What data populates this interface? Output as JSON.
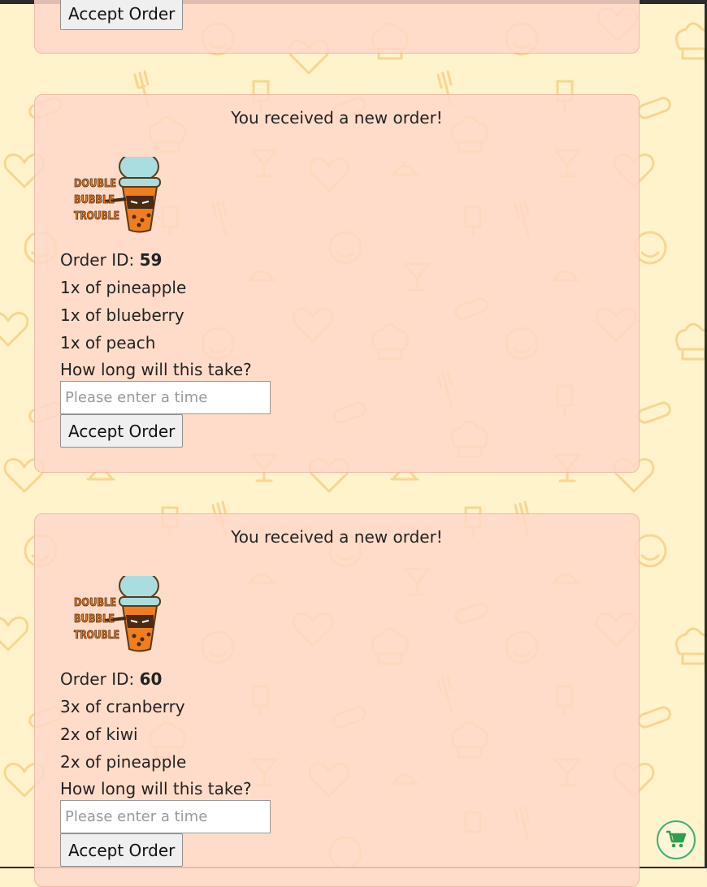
{
  "orders": [
    {
      "accept_label": "Accept Order"
    },
    {
      "title": "You received a new order!",
      "logo_text": [
        "DOUBLE",
        "BUBBLE",
        "TROUBLE"
      ],
      "order_id_label": "Order ID:",
      "order_id": "59",
      "items": [
        "1x of pineapple",
        "1x of blueberry",
        "1x of peach"
      ],
      "time_question": "How long will this take?",
      "time_placeholder": "Please enter a time",
      "time_value": "",
      "accept_label": "Accept Order"
    },
    {
      "title": "You received a new order!",
      "logo_text": [
        "DOUBLE",
        "BUBBLE",
        "TROUBLE"
      ],
      "order_id_label": "Order ID:",
      "order_id": "60",
      "items": [
        "3x of cranberry",
        "2x of kiwi",
        "2x of pineapple"
      ],
      "time_question": "How long will this take?",
      "time_placeholder": "Please enter a time",
      "time_value": "",
      "accept_label": "Accept Order"
    }
  ],
  "cart_button": {
    "icon": "cart-icon"
  },
  "colors": {
    "page_background": "#fff3cc",
    "card_background": "#ffd7c8",
    "pattern": "#f7d38a",
    "logo_orange": "#f07d1e",
    "logo_lid": "#a9dde0",
    "cart_green": "#2e9e4f"
  }
}
